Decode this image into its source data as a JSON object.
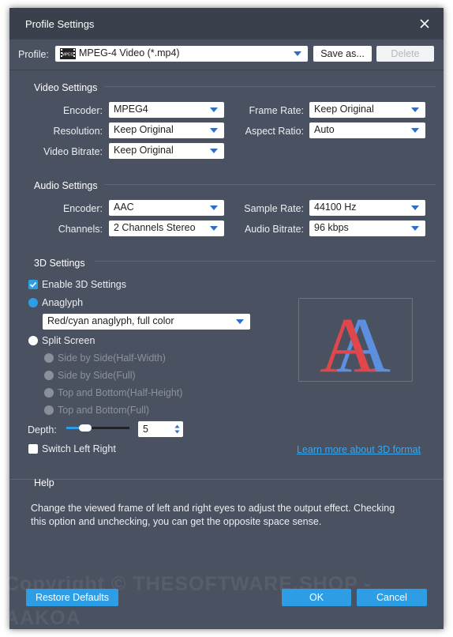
{
  "window": {
    "title": "Profile Settings"
  },
  "profile": {
    "label": "Profile:",
    "value": "MPEG-4 Video (*.mp4)",
    "format_badge": "MPEG",
    "save_as": "Save as...",
    "delete": "Delete"
  },
  "video": {
    "title": "Video Settings",
    "encoder": {
      "label": "Encoder:",
      "value": "MPEG4"
    },
    "resolution": {
      "label": "Resolution:",
      "value": "Keep Original"
    },
    "bitrate": {
      "label": "Video Bitrate:",
      "value": "Keep Original"
    },
    "frame_rate": {
      "label": "Frame Rate:",
      "value": "Keep Original"
    },
    "aspect_ratio": {
      "label": "Aspect Ratio:",
      "value": "Auto"
    }
  },
  "audio": {
    "title": "Audio Settings",
    "encoder": {
      "label": "Encoder:",
      "value": "AAC"
    },
    "channels": {
      "label": "Channels:",
      "value": "2 Channels Stereo"
    },
    "sample_rate": {
      "label": "Sample Rate:",
      "value": "44100 Hz"
    },
    "bitrate": {
      "label": "Audio Bitrate:",
      "value": "96 kbps"
    }
  },
  "threed": {
    "title": "3D Settings",
    "enable": {
      "label": "Enable 3D Settings",
      "checked": true
    },
    "anaglyph": {
      "label": "Anaglyph",
      "selected": true,
      "mode": "Red/cyan anaglyph, full color"
    },
    "split_screen": {
      "label": "Split Screen",
      "selected": false,
      "options": [
        "Side by Side(Half-Width)",
        "Side by Side(Full)",
        "Top and Bottom(Half-Height)",
        "Top and Bottom(Full)"
      ]
    },
    "depth": {
      "label": "Depth:",
      "value": "5",
      "slider_level": 0.25
    },
    "switch_lr": {
      "label": "Switch Left Right",
      "checked": false
    },
    "learn_more": "Learn more about 3D format",
    "preview_letter": "A"
  },
  "help": {
    "title": "Help",
    "text_line1": "Change the viewed frame of left and right eyes to adjust the output effect. Checking",
    "text_line2": "this option and unchecking, you can get the opposite space sense."
  },
  "footer": {
    "restore": "Restore Defaults",
    "ok": "OK",
    "cancel": "Cancel"
  },
  "watermark": {
    "line1": "Copyright ©  THESOFTWARE.SHOP -",
    "line2": "AAKOA"
  },
  "colors": {
    "window_bg": "#4a5261",
    "titlebar_bg": "#3b414c",
    "accent": "#2d9ee6",
    "anaglyph_red": "#e0474c",
    "anaglyph_blue": "#5d8fe0"
  }
}
